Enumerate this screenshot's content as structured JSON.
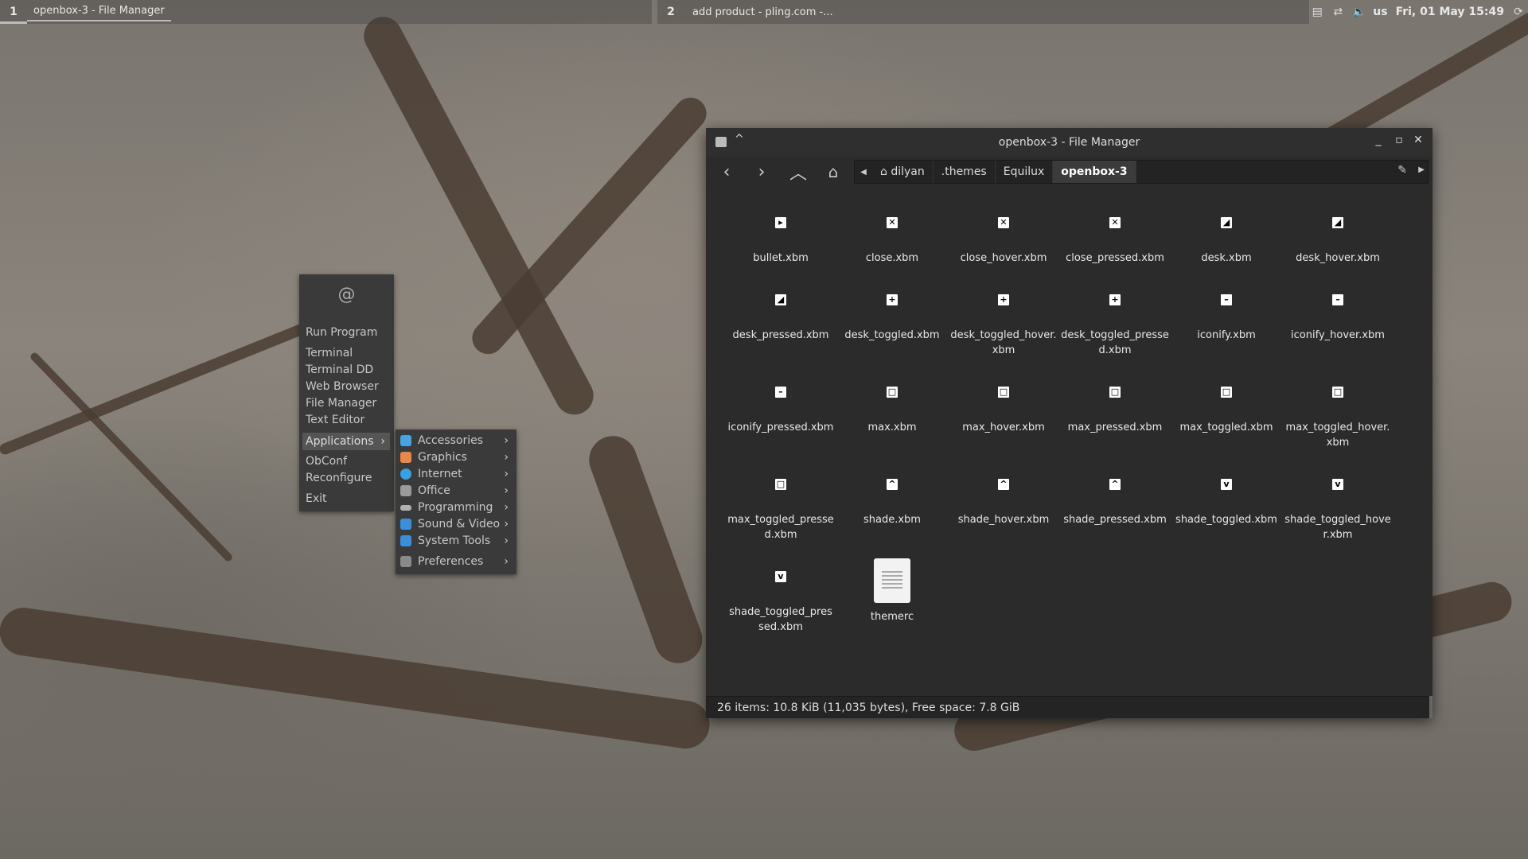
{
  "panel": {
    "tasks": [
      {
        "number": "1",
        "label": "openbox-3 - File Manager"
      },
      {
        "number": "2",
        "label": "add product - pling.com -..."
      }
    ],
    "tray": {
      "icons": [
        "clipboard-icon",
        "network-icon",
        "volume-icon"
      ],
      "keyboard_layout": "us",
      "clock": "Fri, 01 May 15:49"
    }
  },
  "root_menu": {
    "logo": "debian-swirl-icon",
    "items": [
      "Run Program",
      "Terminal",
      "Terminal DD",
      "Web Browser",
      "File Manager",
      "Text Editor"
    ],
    "applications_label": "Applications",
    "lower_items": [
      "ObConf",
      "Reconfigure",
      "Exit"
    ]
  },
  "applications_submenu": {
    "items": [
      {
        "label": "Accessories",
        "color": "#4aa3df"
      },
      {
        "label": "Graphics",
        "color": "#e8874a"
      },
      {
        "label": "Internet",
        "color": "#3aa0e0"
      },
      {
        "label": "Office",
        "color": "#9a9a9a"
      },
      {
        "label": "Programming",
        "color": "#b0b0b0"
      },
      {
        "label": "Sound & Video",
        "color": "#3a8fd8"
      },
      {
        "label": "System Tools",
        "color": "#3a8fd8"
      },
      {
        "label": "Preferences",
        "color": "#8a8a8a"
      }
    ]
  },
  "file_manager": {
    "title": "openbox-3 - File Manager",
    "breadcrumbs": [
      "dilyan",
      ".themes",
      "Equilux",
      "openbox-3"
    ],
    "files": [
      {
        "name": "bullet.xbm",
        "glyph": "▸"
      },
      {
        "name": "close.xbm",
        "glyph": "✕"
      },
      {
        "name": "close_hover.xbm",
        "glyph": "✕"
      },
      {
        "name": "close_pressed.xbm",
        "glyph": "✕"
      },
      {
        "name": "desk.xbm",
        "glyph": "◢"
      },
      {
        "name": "desk_hover.xbm",
        "glyph": "◢"
      },
      {
        "name": "desk_pressed.xbm",
        "glyph": "◢"
      },
      {
        "name": "desk_toggled.xbm",
        "glyph": "+"
      },
      {
        "name": "desk_toggled_hover.xbm",
        "glyph": "+"
      },
      {
        "name": "desk_toggled_pressed.xbm",
        "glyph": "+"
      },
      {
        "name": "iconify.xbm",
        "glyph": "–"
      },
      {
        "name": "iconify_hover.xbm",
        "glyph": "–"
      },
      {
        "name": "iconify_pressed.xbm",
        "glyph": "–"
      },
      {
        "name": "max.xbm",
        "glyph": "□"
      },
      {
        "name": "max_hover.xbm",
        "glyph": "□"
      },
      {
        "name": "max_pressed.xbm",
        "glyph": "□"
      },
      {
        "name": "max_toggled.xbm",
        "glyph": "□"
      },
      {
        "name": "max_toggled_hover.xbm",
        "glyph": "□"
      },
      {
        "name": "max_toggled_pressed.xbm",
        "glyph": "□"
      },
      {
        "name": "shade.xbm",
        "glyph": "^"
      },
      {
        "name": "shade_hover.xbm",
        "glyph": "^"
      },
      {
        "name": "shade_pressed.xbm",
        "glyph": "^"
      },
      {
        "name": "shade_toggled.xbm",
        "glyph": "v"
      },
      {
        "name": "shade_toggled_hover.xbm",
        "glyph": "v"
      },
      {
        "name": "shade_toggled_pressed.xbm",
        "glyph": "v"
      },
      {
        "name": "themerc",
        "glyph": "doc"
      }
    ],
    "status": "26 items: 10.8 KiB (11,035 bytes), Free space: 7.8 GiB"
  }
}
